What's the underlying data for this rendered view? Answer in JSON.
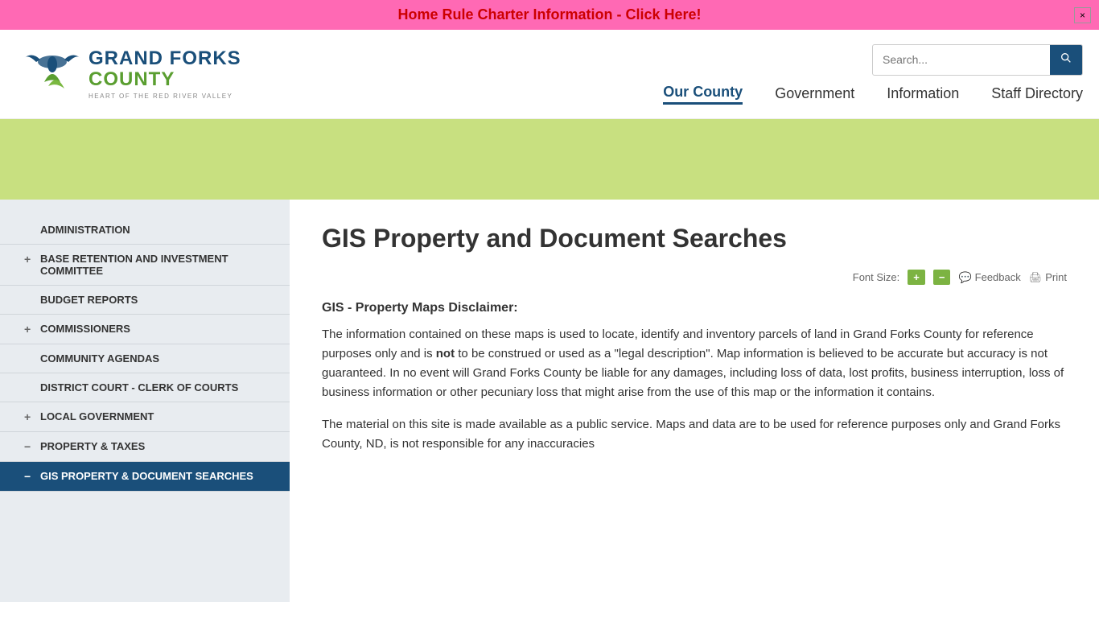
{
  "banner": {
    "text": "Home Rule Charter Information - Click Here!",
    "close_label": "×"
  },
  "logo": {
    "line1": "GRAND FORKS",
    "line2": "COUNTY",
    "tagline": "HEART OF THE RED RIVER VALLEY"
  },
  "search": {
    "placeholder": "Search...",
    "button_label": "🔍"
  },
  "nav": {
    "items": [
      {
        "label": "Our County",
        "active": true
      },
      {
        "label": "Government",
        "active": false
      },
      {
        "label": "Information",
        "active": false
      },
      {
        "label": "Staff Directory",
        "active": false
      }
    ]
  },
  "sidebar": {
    "items": [
      {
        "label": "ADMINISTRATION",
        "toggle": "",
        "active": false
      },
      {
        "label": "BASE RETENTION AND INVESTMENT COMMITTEE",
        "toggle": "+",
        "active": false
      },
      {
        "label": "BUDGET REPORTS",
        "toggle": "",
        "active": false
      },
      {
        "label": "COMMISSIONERS",
        "toggle": "+",
        "active": false
      },
      {
        "label": "COMMUNITY AGENDAS",
        "toggle": "",
        "active": false
      },
      {
        "label": "DISTRICT COURT - CLERK OF COURTS",
        "toggle": "",
        "active": false
      },
      {
        "label": "LOCAL GOVERNMENT",
        "toggle": "+",
        "active": false
      },
      {
        "label": "PROPERTY & TAXES",
        "toggle": "−",
        "active": false
      },
      {
        "label": "GIS Property & Document Searches",
        "toggle": "−",
        "active": true
      }
    ]
  },
  "content": {
    "page_title": "GIS Property and Document Searches",
    "font_size_label": "Font Size:",
    "font_increase_label": "+",
    "font_decrease_label": "−",
    "feedback_label": "Feedback",
    "print_label": "Print",
    "disclaimer_heading": "GIS - Property Maps Disclaimer:",
    "paragraph1": "The information contained on these maps is used to locate, identify and inventory parcels of land in Grand Forks County for reference purposes only and is not to be construed or used as a \"legal description\". Map information is believed to be accurate but accuracy is not guaranteed. In no event will Grand Forks County be liable for any damages, including loss of data, lost profits, business interruption, loss of business information or other pecuniary loss that might arise from the use of this map or the information it contains.",
    "paragraph1_bold": "not",
    "paragraph2": "The material on this site is made available as a public service. Maps and data are to be used for reference purposes only and Grand Forks County, ND, is not responsible for any inaccuracies"
  }
}
